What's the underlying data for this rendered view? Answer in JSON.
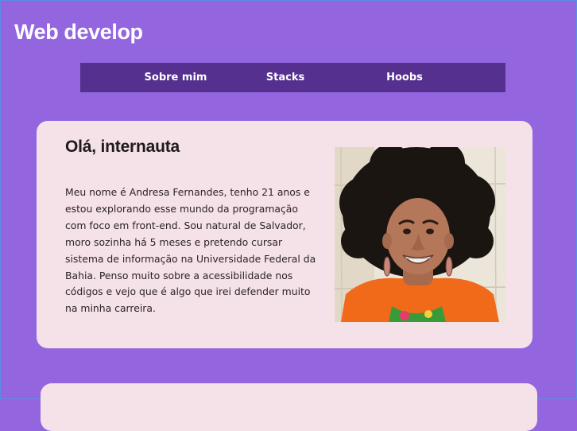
{
  "header": {
    "title": "Web develop"
  },
  "nav": {
    "items": [
      {
        "label": "Sobre mim"
      },
      {
        "label": "Stacks"
      },
      {
        "label": "Hoobs"
      }
    ]
  },
  "about": {
    "heading": "Olá, internauta",
    "paragraph": "Meu nome é Andresa Fernandes, tenho 21 anos e estou explorando esse mundo da programação com foco em front-end. Sou natural de Salvador, moro sozinha há 5 meses e pretendo cursar sistema de informação na Universidade Federal da Bahia. Penso muito sobre a acessibilidade nos códigos e vejo que é algo que irei defender muito na minha carreira."
  },
  "colors": {
    "page_background": "#9366e0",
    "nav_background": "#55308f",
    "card_background": "#f5e1e8"
  }
}
